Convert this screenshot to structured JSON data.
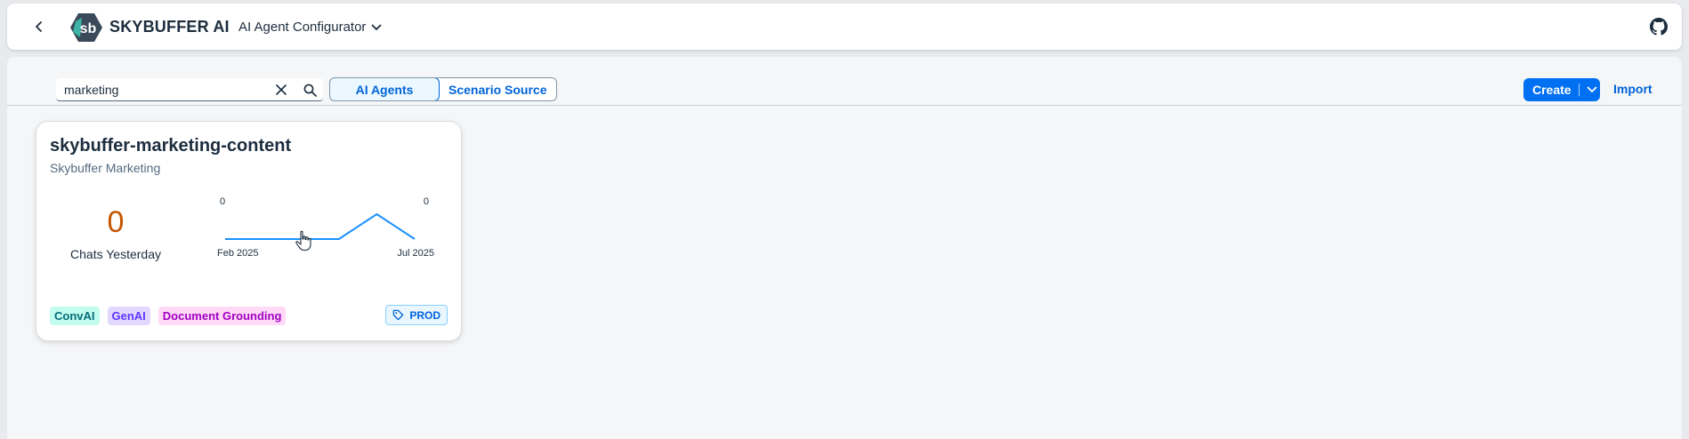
{
  "shellbar": {
    "brand": "SKYBUFFER AI",
    "app_title": "AI Agent Configurator",
    "logo_text": "sb"
  },
  "toolbar": {
    "search": {
      "value": "marketing",
      "placeholder": "Search"
    },
    "segments": [
      {
        "label": "AI Agents",
        "active": true
      },
      {
        "label": "Scenario Source",
        "active": false
      }
    ],
    "create_label": "Create",
    "import_label": "Import"
  },
  "card": {
    "title": "skybuffer-marketing-content",
    "subtitle": "Skybuffer Marketing",
    "kpi_value": "0",
    "kpi_label": "Chats Yesterday",
    "sparkline": {
      "start_value": "0",
      "end_value": "0",
      "start_label": "Feb 2025",
      "end_label": "Jul 2025",
      "points": [
        0,
        0,
        0,
        0,
        1,
        0
      ]
    },
    "tags": [
      "ConvAI",
      "GenAI",
      "Document Grounding"
    ],
    "env_badge": "PROD"
  },
  "colors": {
    "accent": "#0070f2",
    "kpi": "#c35500",
    "spark_line": "#1b90ff"
  }
}
